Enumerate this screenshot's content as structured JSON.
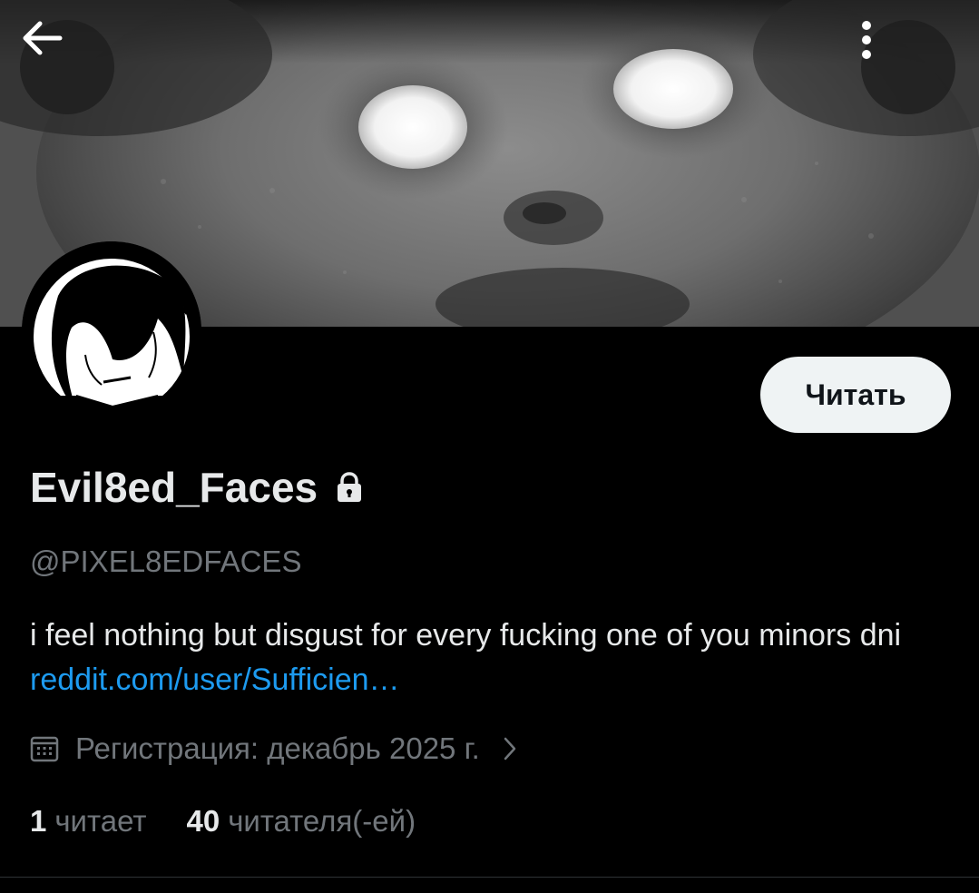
{
  "header": {
    "back_icon": "arrow-left-icon",
    "more_icon": "more-vertical-icon"
  },
  "profile": {
    "display_name": "Evil8ed_Faces",
    "handle": "@PIXEL8EDFACES",
    "bio_text": "i feel nothing but disgust for every fucking one of you minors dni ",
    "bio_link": "reddit.com/user/Sufficien…",
    "joined_text": "Регистрация: декабрь 2025 г.",
    "protected_icon": "lock-icon"
  },
  "actions": {
    "follow_label": "Читать"
  },
  "stats": {
    "following_count": "1",
    "following_label": "читает",
    "followers_count": "40",
    "followers_label": "читателя(-ей)"
  },
  "colors": {
    "background": "#000000",
    "text_primary": "#e7e9ea",
    "text_secondary": "#71767b",
    "link": "#1d9bf0",
    "button_bg": "#eff3f4"
  }
}
